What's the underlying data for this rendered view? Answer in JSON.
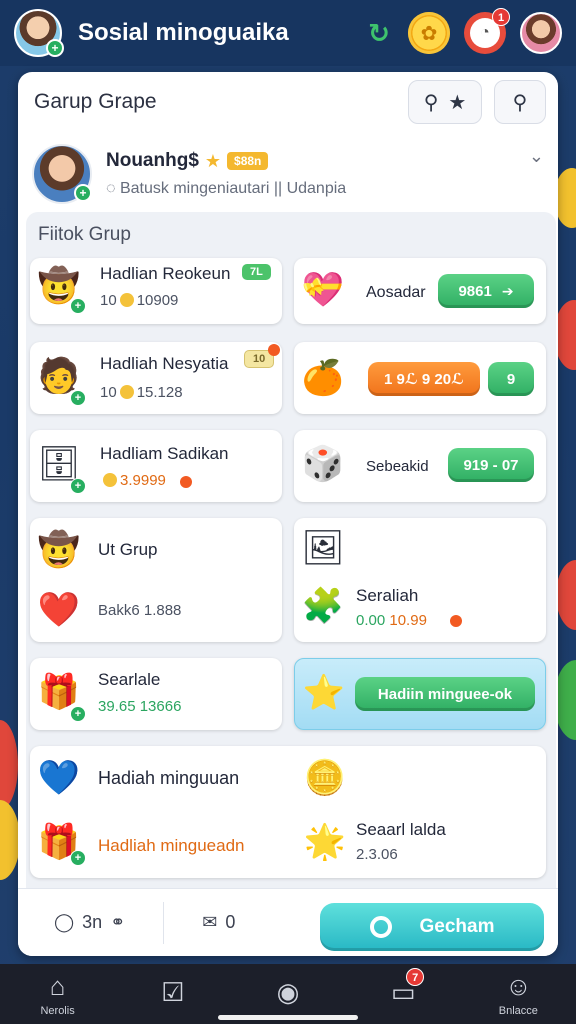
{
  "app": {
    "title": "Sosial minoguaika"
  },
  "topbar": {
    "chat_badge": "1"
  },
  "card": {
    "title": "Garup Grape",
    "profile": {
      "name": "Nouanhg$",
      "vip_label": "$88n",
      "status": "Batusk mingeniautari || Udanpia"
    }
  },
  "section": {
    "title": "Fiitok Grup",
    "left_tiles": [
      {
        "title": "Hadlian Reokeun",
        "tag": "7L",
        "value_a": "10",
        "value_b": "10909"
      },
      {
        "title": "Hadliah Nesyatia",
        "tag": "10",
        "value_a": "10",
        "value_b": "15.128"
      },
      {
        "title": "Hadliam Sadikan",
        "value": "3.9999"
      },
      {
        "title": "Ut Grup",
        "sub": "Bakk6 1.888"
      },
      {
        "title": "Searlale",
        "value_a": "39.65",
        "value_b": "13666"
      }
    ],
    "right_tiles": [
      {
        "label": "Aosadar",
        "pill": "9861"
      },
      {
        "pill": "1 9ℒ 9 20ℒ",
        "pill2": "9"
      },
      {
        "label": "Sebeakid",
        "pill": "919 - 07"
      },
      {
        "title": "Seraliah",
        "value_a": "0.00",
        "value_b": "10.99"
      },
      {
        "pill": "Hadiin minguee-ok"
      }
    ],
    "wide_tile": {
      "title_a": "Hadiah minguuan",
      "title_b": "Hadliah mingueadn",
      "right_title": "Seaarl lalda",
      "right_value": "2.3.06"
    }
  },
  "bottom_bar": {
    "count_label": "3n",
    "mail_label": "0",
    "chat_button": "Gecham"
  },
  "nav": {
    "items": [
      {
        "label": "Nerolis"
      },
      {
        "label": ""
      },
      {
        "label": ""
      },
      {
        "label": "",
        "badge": "7"
      },
      {
        "label": "Bnlacce"
      }
    ]
  }
}
